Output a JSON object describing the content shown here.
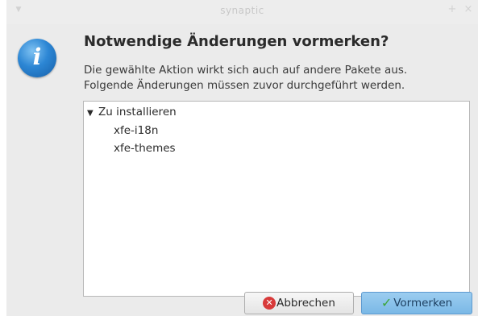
{
  "window": {
    "title": "synaptic"
  },
  "dialog": {
    "heading": "Notwendige Änderungen vormerken?",
    "description_line1": "Die gewählte Aktion wirkt sich auch auf andere Pakete aus.",
    "description_line2": "Folgende Änderungen müssen zuvor durchgeführt werden."
  },
  "changes_tree": {
    "group_label": "Zu installieren",
    "group_expanded": true,
    "items": [
      "xfe-i18n",
      "xfe-themes"
    ]
  },
  "buttons": {
    "cancel_label": "Abbrechen",
    "apply_label": "Vormerken"
  },
  "icons": {
    "info": "info-icon",
    "cancel": "cancel-icon",
    "apply": "checkmark-icon"
  },
  "colors": {
    "info_icon": "#2c86d4",
    "apply_button": "#8cc3ec",
    "cancel_icon": "#d83a3a",
    "check_icon": "#3da53a"
  }
}
